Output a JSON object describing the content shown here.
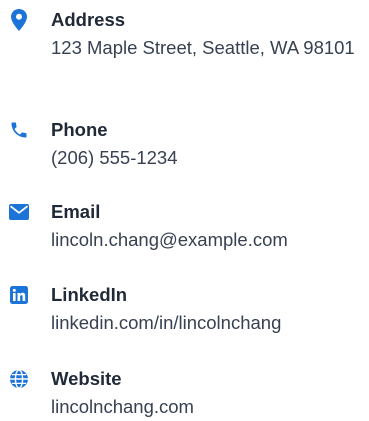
{
  "accent_color": "#1d74d8",
  "contacts": [
    {
      "icon": "map-pin-icon",
      "label": "Address",
      "value": "123 Maple Street, Seattle, WA 98101"
    },
    {
      "icon": "phone-icon",
      "label": "Phone",
      "value": "(206) 555-1234"
    },
    {
      "icon": "envelope-icon",
      "label": "Email",
      "value": "lincoln.chang@example.com"
    },
    {
      "icon": "linkedin-icon",
      "label": "LinkedIn",
      "value": "linkedin.com/in/lincolnchang"
    },
    {
      "icon": "globe-icon",
      "label": "Website",
      "value": "lincolnchang.com"
    }
  ]
}
